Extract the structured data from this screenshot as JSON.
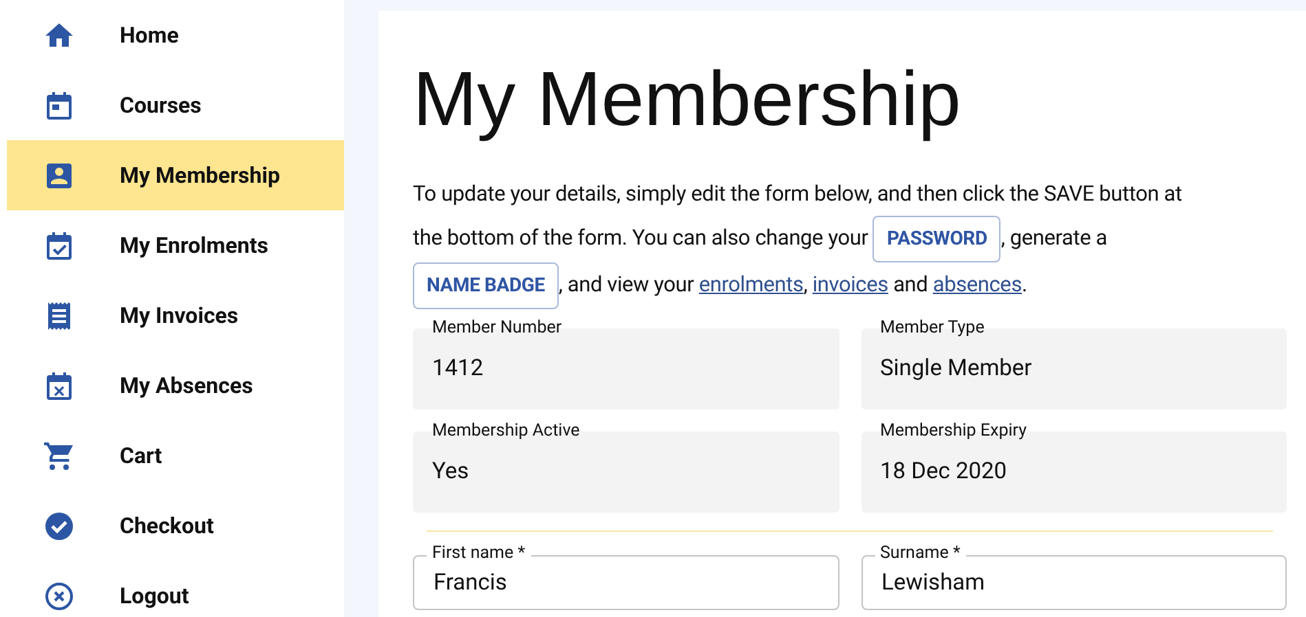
{
  "sidebar": {
    "items": [
      {
        "label": "Home",
        "selected": false
      },
      {
        "label": "Courses",
        "selected": false
      },
      {
        "label": "My Membership",
        "selected": true
      },
      {
        "label": "My Enrolments",
        "selected": false
      },
      {
        "label": "My Invoices",
        "selected": false
      },
      {
        "label": "My Absences",
        "selected": false
      },
      {
        "label": "Cart",
        "selected": false
      },
      {
        "label": "Checkout",
        "selected": false
      },
      {
        "label": "Logout",
        "selected": false
      }
    ]
  },
  "page": {
    "title": "My Membership",
    "intro": [
      {
        "kind": "text",
        "text": "To update your details, simply edit the form below, and then click the SAVE button at the bottom of the form. You can also change your"
      },
      {
        "kind": "button",
        "text": "PASSWORD"
      },
      {
        "kind": "text",
        "text": ", generate a"
      },
      {
        "kind": "button",
        "text": "NAME BADGE"
      },
      {
        "kind": "text",
        "text": ", and view your"
      },
      {
        "kind": "link",
        "text": "enrolments"
      },
      {
        "kind": "text",
        "text": ","
      },
      {
        "kind": "link",
        "text": "invoices"
      },
      {
        "kind": "text",
        "text": "and"
      },
      {
        "kind": "link",
        "text": "absences"
      },
      {
        "kind": "text",
        "text": "."
      }
    ],
    "info_fields": [
      {
        "label": "Member Number",
        "value": "1412"
      },
      {
        "label": "Member Type",
        "value": "Single Member"
      },
      {
        "label": "Membership Active",
        "value": "Yes"
      },
      {
        "label": "Membership Expiry",
        "value": "18 Dec 2020"
      }
    ],
    "form_fields": [
      {
        "label": "First name *",
        "value": "Francis"
      },
      {
        "label": "Surname *",
        "value": "Lewisham"
      }
    ]
  }
}
